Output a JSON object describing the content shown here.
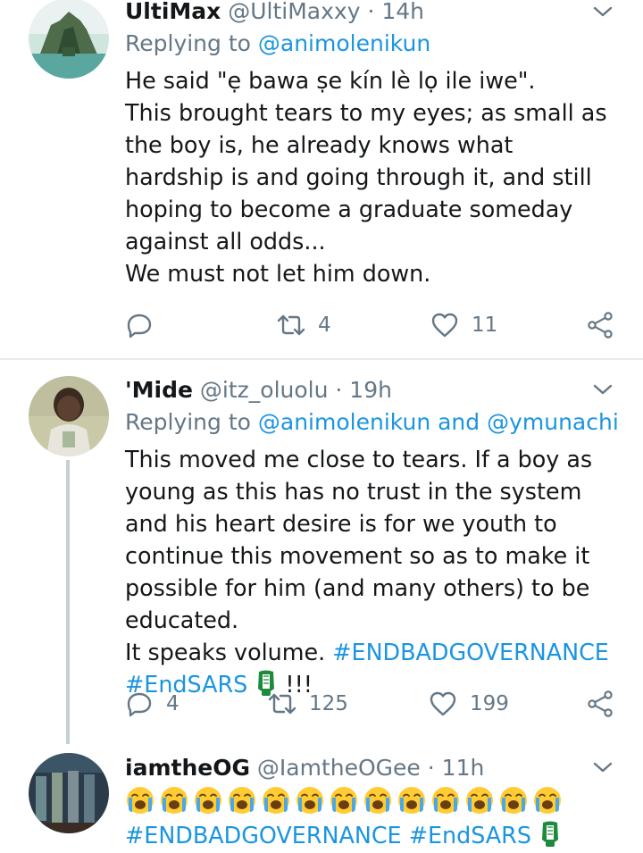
{
  "tweets": [
    {
      "name": "UltiMax",
      "handle": "@UltiMaxxy",
      "time": "· 14h",
      "replying_prefix": "Replying to ",
      "replying_to": "@animolenikun",
      "lines": [
        "He said \"ẹ bawa ṣe kín lè lọ ile iwe\".",
        "This brought tears to my eyes; as small as the boy is, he already knows what hardship is and going through it, and still hoping to become a graduate someday against all odds...",
        "We must not let him down."
      ],
      "retweets": "4",
      "likes": "11"
    },
    {
      "name": "'Mide",
      "handle": "@itz_oluolu",
      "time": "· 19h",
      "replying_prefix": "Replying to ",
      "replying_to": "@animolenikun and @ymunachi",
      "lines": [
        "This moved me close to tears. If a boy as young as this has no trust in the system and his heart desire is for we youth to continue this movement so as to make it possible for him (and many others) to be educated."
      ],
      "last_line_text": "It speaks volume. ",
      "hashtag1": "#ENDBADGOVERNANCE",
      "hashtag2": "#EndSARS",
      "suffix": "!!!",
      "replies": "4",
      "retweets": "125",
      "likes": "199"
    },
    {
      "name": "iamtheOG",
      "handle": "@IamtheOGee",
      "time": "· 11h",
      "emoji_name": "loudly-crying-face",
      "emoji_count": 13,
      "hashtag1": "#ENDBADGOVERNANCE",
      "hashtag2": "#EndSARS"
    }
  ],
  "colors": {
    "link": "#1b95e0",
    "meta": "#657786",
    "divider": "#e6ecf0",
    "thread_line": "#c4cfd6"
  }
}
